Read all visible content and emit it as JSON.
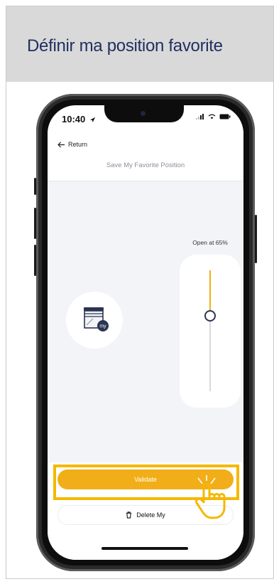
{
  "header": {
    "title": "Définir ma position favorite"
  },
  "status_bar": {
    "time": "10:40"
  },
  "nav": {
    "back_label": "Return",
    "title": "Save My Favorite Position"
  },
  "slider": {
    "label": "Open at 65%",
    "open_percent": 65
  },
  "actions": {
    "validate_label": "Validate",
    "delete_label": "Delete My"
  },
  "colors": {
    "accent": "#f2ae18",
    "highlight": "#f5b800",
    "header_bg": "#d9d9d9",
    "title_text": "#1f2f5f"
  },
  "icons": [
    "arrow-left-icon",
    "location-arrow-icon",
    "signal-icon",
    "wifi-icon",
    "battery-icon",
    "shade-device-icon",
    "trash-icon",
    "pointing-hand-icon"
  ]
}
